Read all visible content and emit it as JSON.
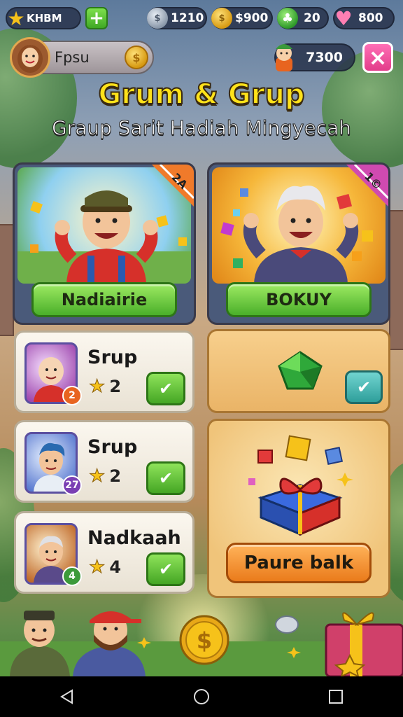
{
  "topbar": {
    "level_label": "KHBM",
    "silver": "1210",
    "gold": "$900",
    "clover": "20",
    "hearts": "800"
  },
  "profile": {
    "name": "Fpsu",
    "coin_glyph": "$",
    "score": "7300"
  },
  "header": {
    "title": "Grum & Grup",
    "subtitle": "Graup Sarit Hadiah Mingyecah"
  },
  "cards": [
    {
      "button_label": "Nadiairie",
      "corner_text": "2A"
    },
    {
      "button_label": "BOKUY",
      "corner_text": "1©"
    }
  ],
  "missions": [
    {
      "name": "Srup",
      "stars": "2",
      "badge": "2",
      "badge_color": "#e8641f"
    },
    {
      "name": "Srup",
      "stars": "2",
      "badge": "27",
      "badge_color": "#7a3fb3"
    },
    {
      "name": "Nadkaah",
      "stars": "4",
      "badge": "4",
      "badge_color": "#3c9a3a"
    }
  ],
  "gift": {
    "button_label": "Paure balk"
  },
  "colors": {
    "accent_green": "#4aaf2a",
    "accent_orange": "#ea7b1b",
    "title_yellow": "#ffe21a",
    "close_pink": "#e23d8a"
  },
  "icons": [
    "star-icon",
    "plus-icon",
    "silver-coin-icon",
    "gold-coin-icon",
    "clover-icon",
    "heart-icon",
    "close-icon",
    "check-icon",
    "gem-icon",
    "gift-icon",
    "back-icon",
    "home-icon",
    "recents-icon"
  ]
}
